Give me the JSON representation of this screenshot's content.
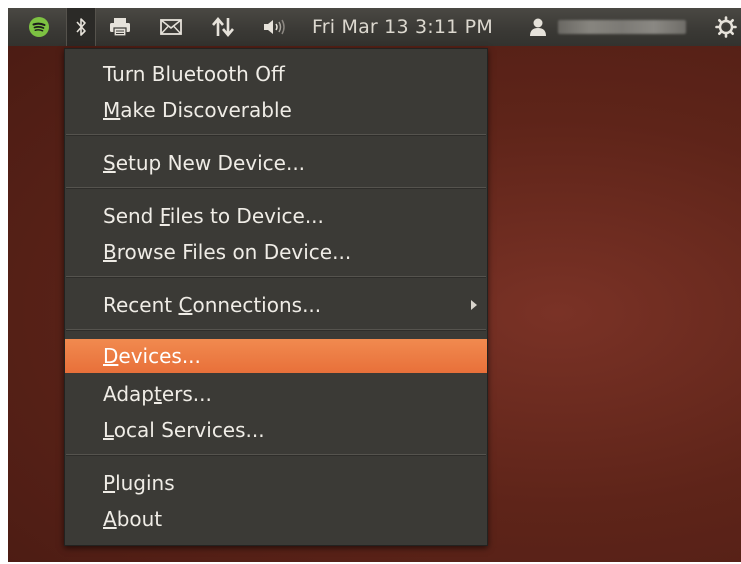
{
  "topbar": {
    "clock": "Fri Mar 13  3:11 PM",
    "icons": [
      "spotify-icon",
      "bluetooth-icon",
      "printer-icon",
      "mail-icon",
      "network-icon",
      "volume-icon",
      "user-icon",
      "power-icon"
    ]
  },
  "menu": {
    "items": [
      {
        "label": "Turn Bluetooth Off",
        "accelerator": ""
      },
      {
        "label": "Make Discoverable",
        "accelerator": "M"
      },
      {
        "label": "Setup New Device...",
        "accelerator": "S"
      },
      {
        "label": "Send Files to Device...",
        "accelerator": "F"
      },
      {
        "label": "Browse Files on Device...",
        "accelerator": "B"
      },
      {
        "label": "Recent Connections...",
        "accelerator": "C",
        "has_submenu": true
      },
      {
        "label": "Devices...",
        "accelerator": "D",
        "highlighted": true
      },
      {
        "label": "Adapters...",
        "accelerator": "t"
      },
      {
        "label": "Local Services...",
        "accelerator": "L"
      },
      {
        "label": "Plugins",
        "accelerator": "P"
      },
      {
        "label": "About",
        "accelerator": "A"
      }
    ]
  },
  "colors": {
    "panel": "#3a3935",
    "menu_bg": "#3b3a36",
    "highlight": "#ec7a43",
    "desktop": "#5e2419",
    "spotify_green": "#7dc242"
  }
}
